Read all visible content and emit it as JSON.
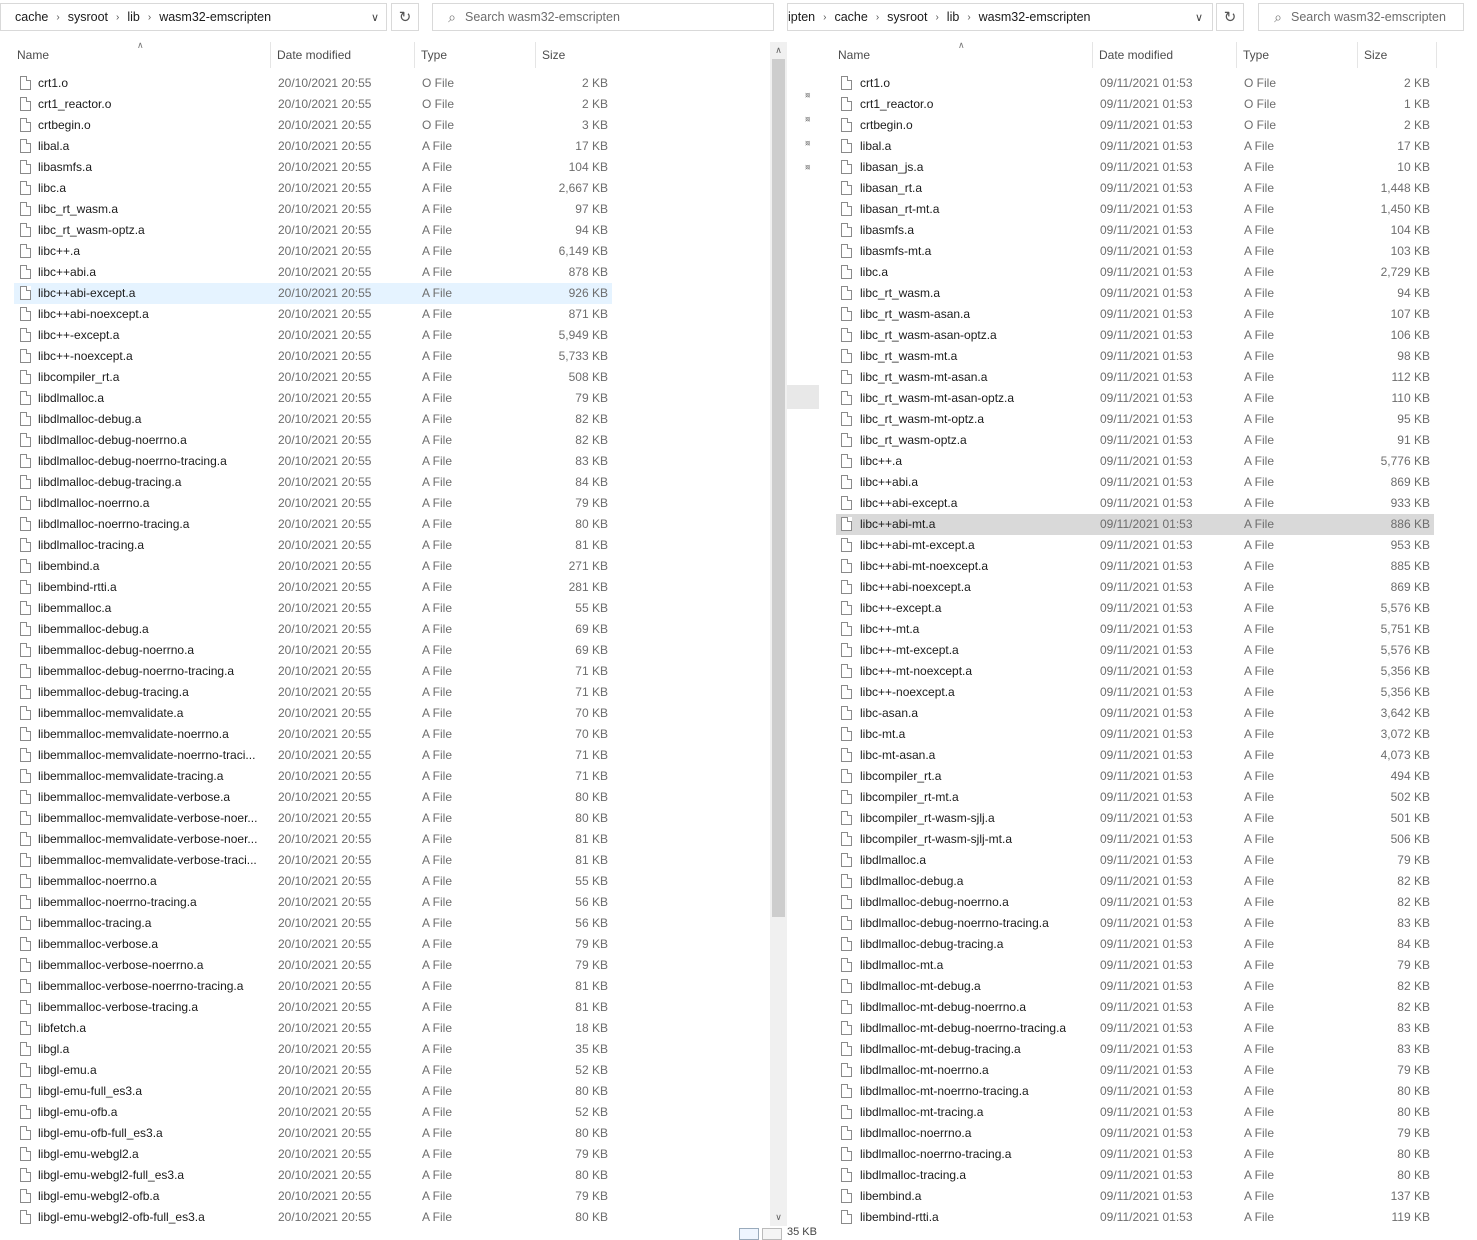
{
  "left": {
    "breadcrumb": [
      "cache",
      "sysroot",
      "lib",
      "wasm32-emscripten"
    ],
    "search_placeholder": "Search wasm32-emscripten",
    "columns": {
      "name": "Name",
      "date": "Date modified",
      "type": "Type",
      "size": "Size"
    },
    "rows": [
      {
        "name": "crt1.o",
        "date": "20/10/2021 20:55",
        "type": "O File",
        "size": "2 KB"
      },
      {
        "name": "crt1_reactor.o",
        "date": "20/10/2021 20:55",
        "type": "O File",
        "size": "2 KB"
      },
      {
        "name": "crtbegin.o",
        "date": "20/10/2021 20:55",
        "type": "O File",
        "size": "3 KB"
      },
      {
        "name": "libal.a",
        "date": "20/10/2021 20:55",
        "type": "A File",
        "size": "17 KB"
      },
      {
        "name": "libasmfs.a",
        "date": "20/10/2021 20:55",
        "type": "A File",
        "size": "104 KB"
      },
      {
        "name": "libc.a",
        "date": "20/10/2021 20:55",
        "type": "A File",
        "size": "2,667 KB"
      },
      {
        "name": "libc_rt_wasm.a",
        "date": "20/10/2021 20:55",
        "type": "A File",
        "size": "97 KB"
      },
      {
        "name": "libc_rt_wasm-optz.a",
        "date": "20/10/2021 20:55",
        "type": "A File",
        "size": "94 KB"
      },
      {
        "name": "libc++.a",
        "date": "20/10/2021 20:55",
        "type": "A File",
        "size": "6,149 KB"
      },
      {
        "name": "libc++abi.a",
        "date": "20/10/2021 20:55",
        "type": "A File",
        "size": "878 KB"
      },
      {
        "name": "libc++abi-except.a",
        "date": "20/10/2021 20:55",
        "type": "A File",
        "size": "926 KB"
      },
      {
        "name": "libc++abi-noexcept.a",
        "date": "20/10/2021 20:55",
        "type": "A File",
        "size": "871 KB"
      },
      {
        "name": "libc++-except.a",
        "date": "20/10/2021 20:55",
        "type": "A File",
        "size": "5,949 KB"
      },
      {
        "name": "libc++-noexcept.a",
        "date": "20/10/2021 20:55",
        "type": "A File",
        "size": "5,733 KB"
      },
      {
        "name": "libcompiler_rt.a",
        "date": "20/10/2021 20:55",
        "type": "A File",
        "size": "508 KB"
      },
      {
        "name": "libdlmalloc.a",
        "date": "20/10/2021 20:55",
        "type": "A File",
        "size": "79 KB"
      },
      {
        "name": "libdlmalloc-debug.a",
        "date": "20/10/2021 20:55",
        "type": "A File",
        "size": "82 KB"
      },
      {
        "name": "libdlmalloc-debug-noerrno.a",
        "date": "20/10/2021 20:55",
        "type": "A File",
        "size": "82 KB"
      },
      {
        "name": "libdlmalloc-debug-noerrno-tracing.a",
        "date": "20/10/2021 20:55",
        "type": "A File",
        "size": "83 KB"
      },
      {
        "name": "libdlmalloc-debug-tracing.a",
        "date": "20/10/2021 20:55",
        "type": "A File",
        "size": "84 KB"
      },
      {
        "name": "libdlmalloc-noerrno.a",
        "date": "20/10/2021 20:55",
        "type": "A File",
        "size": "79 KB"
      },
      {
        "name": "libdlmalloc-noerrno-tracing.a",
        "date": "20/10/2021 20:55",
        "type": "A File",
        "size": "80 KB"
      },
      {
        "name": "libdlmalloc-tracing.a",
        "date": "20/10/2021 20:55",
        "type": "A File",
        "size": "81 KB"
      },
      {
        "name": "libembind.a",
        "date": "20/10/2021 20:55",
        "type": "A File",
        "size": "271 KB"
      },
      {
        "name": "libembind-rtti.a",
        "date": "20/10/2021 20:55",
        "type": "A File",
        "size": "281 KB"
      },
      {
        "name": "libemmalloc.a",
        "date": "20/10/2021 20:55",
        "type": "A File",
        "size": "55 KB"
      },
      {
        "name": "libemmalloc-debug.a",
        "date": "20/10/2021 20:55",
        "type": "A File",
        "size": "69 KB"
      },
      {
        "name": "libemmalloc-debug-noerrno.a",
        "date": "20/10/2021 20:55",
        "type": "A File",
        "size": "69 KB"
      },
      {
        "name": "libemmalloc-debug-noerrno-tracing.a",
        "date": "20/10/2021 20:55",
        "type": "A File",
        "size": "71 KB"
      },
      {
        "name": "libemmalloc-debug-tracing.a",
        "date": "20/10/2021 20:55",
        "type": "A File",
        "size": "71 KB"
      },
      {
        "name": "libemmalloc-memvalidate.a",
        "date": "20/10/2021 20:55",
        "type": "A File",
        "size": "70 KB"
      },
      {
        "name": "libemmalloc-memvalidate-noerrno.a",
        "date": "20/10/2021 20:55",
        "type": "A File",
        "size": "70 KB"
      },
      {
        "name": "libemmalloc-memvalidate-noerrno-traci...",
        "date": "20/10/2021 20:55",
        "type": "A File",
        "size": "71 KB"
      },
      {
        "name": "libemmalloc-memvalidate-tracing.a",
        "date": "20/10/2021 20:55",
        "type": "A File",
        "size": "71 KB"
      },
      {
        "name": "libemmalloc-memvalidate-verbose.a",
        "date": "20/10/2021 20:55",
        "type": "A File",
        "size": "80 KB"
      },
      {
        "name": "libemmalloc-memvalidate-verbose-noer...",
        "date": "20/10/2021 20:55",
        "type": "A File",
        "size": "80 KB"
      },
      {
        "name": "libemmalloc-memvalidate-verbose-noer...",
        "date": "20/10/2021 20:55",
        "type": "A File",
        "size": "81 KB"
      },
      {
        "name": "libemmalloc-memvalidate-verbose-traci...",
        "date": "20/10/2021 20:55",
        "type": "A File",
        "size": "81 KB"
      },
      {
        "name": "libemmalloc-noerrno.a",
        "date": "20/10/2021 20:55",
        "type": "A File",
        "size": "55 KB"
      },
      {
        "name": "libemmalloc-noerrno-tracing.a",
        "date": "20/10/2021 20:55",
        "type": "A File",
        "size": "56 KB"
      },
      {
        "name": "libemmalloc-tracing.a",
        "date": "20/10/2021 20:55",
        "type": "A File",
        "size": "56 KB"
      },
      {
        "name": "libemmalloc-verbose.a",
        "date": "20/10/2021 20:55",
        "type": "A File",
        "size": "79 KB"
      },
      {
        "name": "libemmalloc-verbose-noerrno.a",
        "date": "20/10/2021 20:55",
        "type": "A File",
        "size": "79 KB"
      },
      {
        "name": "libemmalloc-verbose-noerrno-tracing.a",
        "date": "20/10/2021 20:55",
        "type": "A File",
        "size": "81 KB"
      },
      {
        "name": "libemmalloc-verbose-tracing.a",
        "date": "20/10/2021 20:55",
        "type": "A File",
        "size": "81 KB"
      },
      {
        "name": "libfetch.a",
        "date": "20/10/2021 20:55",
        "type": "A File",
        "size": "18 KB"
      },
      {
        "name": "libgl.a",
        "date": "20/10/2021 20:55",
        "type": "A File",
        "size": "35 KB"
      },
      {
        "name": "libgl-emu.a",
        "date": "20/10/2021 20:55",
        "type": "A File",
        "size": "52 KB"
      },
      {
        "name": "libgl-emu-full_es3.a",
        "date": "20/10/2021 20:55",
        "type": "A File",
        "size": "80 KB"
      },
      {
        "name": "libgl-emu-ofb.a",
        "date": "20/10/2021 20:55",
        "type": "A File",
        "size": "52 KB"
      },
      {
        "name": "libgl-emu-ofb-full_es3.a",
        "date": "20/10/2021 20:55",
        "type": "A File",
        "size": "80 KB"
      },
      {
        "name": "libgl-emu-webgl2.a",
        "date": "20/10/2021 20:55",
        "type": "A File",
        "size": "79 KB"
      },
      {
        "name": "libgl-emu-webgl2-full_es3.a",
        "date": "20/10/2021 20:55",
        "type": "A File",
        "size": "80 KB"
      },
      {
        "name": "libgl-emu-webgl2-ofb.a",
        "date": "20/10/2021 20:55",
        "type": "A File",
        "size": "79 KB"
      },
      {
        "name": "libgl-emu-webgl2-ofb-full_es3.a",
        "date": "20/10/2021 20:55",
        "type": "A File",
        "size": "80 KB"
      }
    ]
  },
  "right": {
    "breadcrumb": [
      "ipten",
      "cache",
      "sysroot",
      "lib",
      "wasm32-emscripten"
    ],
    "search_placeholder": "Search wasm32-emscripten",
    "status_text": "35 KB",
    "columns": {
      "name": "Name",
      "date": "Date modified",
      "type": "Type",
      "size": "Size"
    },
    "rows": [
      {
        "name": "crt1.o",
        "date": "09/11/2021 01:53",
        "type": "O File",
        "size": "2 KB"
      },
      {
        "name": "crt1_reactor.o",
        "date": "09/11/2021 01:53",
        "type": "O File",
        "size": "1 KB"
      },
      {
        "name": "crtbegin.o",
        "date": "09/11/2021 01:53",
        "type": "O File",
        "size": "2 KB"
      },
      {
        "name": "libal.a",
        "date": "09/11/2021 01:53",
        "type": "A File",
        "size": "17 KB"
      },
      {
        "name": "libasan_js.a",
        "date": "09/11/2021 01:53",
        "type": "A File",
        "size": "10 KB"
      },
      {
        "name": "libasan_rt.a",
        "date": "09/11/2021 01:53",
        "type": "A File",
        "size": "1,448 KB"
      },
      {
        "name": "libasan_rt-mt.a",
        "date": "09/11/2021 01:53",
        "type": "A File",
        "size": "1,450 KB"
      },
      {
        "name": "libasmfs.a",
        "date": "09/11/2021 01:53",
        "type": "A File",
        "size": "104 KB"
      },
      {
        "name": "libasmfs-mt.a",
        "date": "09/11/2021 01:53",
        "type": "A File",
        "size": "103 KB"
      },
      {
        "name": "libc.a",
        "date": "09/11/2021 01:53",
        "type": "A File",
        "size": "2,729 KB"
      },
      {
        "name": "libc_rt_wasm.a",
        "date": "09/11/2021 01:53",
        "type": "A File",
        "size": "94 KB"
      },
      {
        "name": "libc_rt_wasm-asan.a",
        "date": "09/11/2021 01:53",
        "type": "A File",
        "size": "107 KB"
      },
      {
        "name": "libc_rt_wasm-asan-optz.a",
        "date": "09/11/2021 01:53",
        "type": "A File",
        "size": "106 KB"
      },
      {
        "name": "libc_rt_wasm-mt.a",
        "date": "09/11/2021 01:53",
        "type": "A File",
        "size": "98 KB"
      },
      {
        "name": "libc_rt_wasm-mt-asan.a",
        "date": "09/11/2021 01:53",
        "type": "A File",
        "size": "112 KB"
      },
      {
        "name": "libc_rt_wasm-mt-asan-optz.a",
        "date": "09/11/2021 01:53",
        "type": "A File",
        "size": "110 KB"
      },
      {
        "name": "libc_rt_wasm-mt-optz.a",
        "date": "09/11/2021 01:53",
        "type": "A File",
        "size": "95 KB"
      },
      {
        "name": "libc_rt_wasm-optz.a",
        "date": "09/11/2021 01:53",
        "type": "A File",
        "size": "91 KB"
      },
      {
        "name": "libc++.a",
        "date": "09/11/2021 01:53",
        "type": "A File",
        "size": "5,776 KB"
      },
      {
        "name": "libc++abi.a",
        "date": "09/11/2021 01:53",
        "type": "A File",
        "size": "869 KB"
      },
      {
        "name": "libc++abi-except.a",
        "date": "09/11/2021 01:53",
        "type": "A File",
        "size": "933 KB"
      },
      {
        "name": "libc++abi-mt.a",
        "date": "09/11/2021 01:53",
        "type": "A File",
        "size": "886 KB"
      },
      {
        "name": "libc++abi-mt-except.a",
        "date": "09/11/2021 01:53",
        "type": "A File",
        "size": "953 KB"
      },
      {
        "name": "libc++abi-mt-noexcept.a",
        "date": "09/11/2021 01:53",
        "type": "A File",
        "size": "885 KB"
      },
      {
        "name": "libc++abi-noexcept.a",
        "date": "09/11/2021 01:53",
        "type": "A File",
        "size": "869 KB"
      },
      {
        "name": "libc++-except.a",
        "date": "09/11/2021 01:53",
        "type": "A File",
        "size": "5,576 KB"
      },
      {
        "name": "libc++-mt.a",
        "date": "09/11/2021 01:53",
        "type": "A File",
        "size": "5,751 KB"
      },
      {
        "name": "libc++-mt-except.a",
        "date": "09/11/2021 01:53",
        "type": "A File",
        "size": "5,576 KB"
      },
      {
        "name": "libc++-mt-noexcept.a",
        "date": "09/11/2021 01:53",
        "type": "A File",
        "size": "5,356 KB"
      },
      {
        "name": "libc++-noexcept.a",
        "date": "09/11/2021 01:53",
        "type": "A File",
        "size": "5,356 KB"
      },
      {
        "name": "libc-asan.a",
        "date": "09/11/2021 01:53",
        "type": "A File",
        "size": "3,642 KB"
      },
      {
        "name": "libc-mt.a",
        "date": "09/11/2021 01:53",
        "type": "A File",
        "size": "3,072 KB"
      },
      {
        "name": "libc-mt-asan.a",
        "date": "09/11/2021 01:53",
        "type": "A File",
        "size": "4,073 KB"
      },
      {
        "name": "libcompiler_rt.a",
        "date": "09/11/2021 01:53",
        "type": "A File",
        "size": "494 KB"
      },
      {
        "name": "libcompiler_rt-mt.a",
        "date": "09/11/2021 01:53",
        "type": "A File",
        "size": "502 KB"
      },
      {
        "name": "libcompiler_rt-wasm-sjlj.a",
        "date": "09/11/2021 01:53",
        "type": "A File",
        "size": "501 KB"
      },
      {
        "name": "libcompiler_rt-wasm-sjlj-mt.a",
        "date": "09/11/2021 01:53",
        "type": "A File",
        "size": "506 KB"
      },
      {
        "name": "libdlmalloc.a",
        "date": "09/11/2021 01:53",
        "type": "A File",
        "size": "79 KB"
      },
      {
        "name": "libdlmalloc-debug.a",
        "date": "09/11/2021 01:53",
        "type": "A File",
        "size": "82 KB"
      },
      {
        "name": "libdlmalloc-debug-noerrno.a",
        "date": "09/11/2021 01:53",
        "type": "A File",
        "size": "82 KB"
      },
      {
        "name": "libdlmalloc-debug-noerrno-tracing.a",
        "date": "09/11/2021 01:53",
        "type": "A File",
        "size": "83 KB"
      },
      {
        "name": "libdlmalloc-debug-tracing.a",
        "date": "09/11/2021 01:53",
        "type": "A File",
        "size": "84 KB"
      },
      {
        "name": "libdlmalloc-mt.a",
        "date": "09/11/2021 01:53",
        "type": "A File",
        "size": "79 KB"
      },
      {
        "name": "libdlmalloc-mt-debug.a",
        "date": "09/11/2021 01:53",
        "type": "A File",
        "size": "82 KB"
      },
      {
        "name": "libdlmalloc-mt-debug-noerrno.a",
        "date": "09/11/2021 01:53",
        "type": "A File",
        "size": "82 KB"
      },
      {
        "name": "libdlmalloc-mt-debug-noerrno-tracing.a",
        "date": "09/11/2021 01:53",
        "type": "A File",
        "size": "83 KB"
      },
      {
        "name": "libdlmalloc-mt-debug-tracing.a",
        "date": "09/11/2021 01:53",
        "type": "A File",
        "size": "83 KB"
      },
      {
        "name": "libdlmalloc-mt-noerrno.a",
        "date": "09/11/2021 01:53",
        "type": "A File",
        "size": "79 KB"
      },
      {
        "name": "libdlmalloc-mt-noerrno-tracing.a",
        "date": "09/11/2021 01:53",
        "type": "A File",
        "size": "80 KB"
      },
      {
        "name": "libdlmalloc-mt-tracing.a",
        "date": "09/11/2021 01:53",
        "type": "A File",
        "size": "80 KB"
      },
      {
        "name": "libdlmalloc-noerrno.a",
        "date": "09/11/2021 01:53",
        "type": "A File",
        "size": "79 KB"
      },
      {
        "name": "libdlmalloc-noerrno-tracing.a",
        "date": "09/11/2021 01:53",
        "type": "A File",
        "size": "80 KB"
      },
      {
        "name": "libdlmalloc-tracing.a",
        "date": "09/11/2021 01:53",
        "type": "A File",
        "size": "80 KB"
      },
      {
        "name": "libembind.a",
        "date": "09/11/2021 01:53",
        "type": "A File",
        "size": "137 KB"
      },
      {
        "name": "libembind-rtti.a",
        "date": "09/11/2021 01:53",
        "type": "A File",
        "size": "119 KB"
      }
    ]
  },
  "selection": {
    "left_row": 10,
    "right_row": 21
  },
  "colors": {
    "hover": "#e5f3ff",
    "selected_gray": "#d9d9d9",
    "text": "#1b1b1b",
    "muted": "#6d6d6d"
  },
  "icons": [
    "chevron-right-icon",
    "chevron-down-icon",
    "refresh-icon",
    "search-icon",
    "file-icon",
    "pin-icon",
    "details-view-icon",
    "large-icons-view-icon"
  ]
}
